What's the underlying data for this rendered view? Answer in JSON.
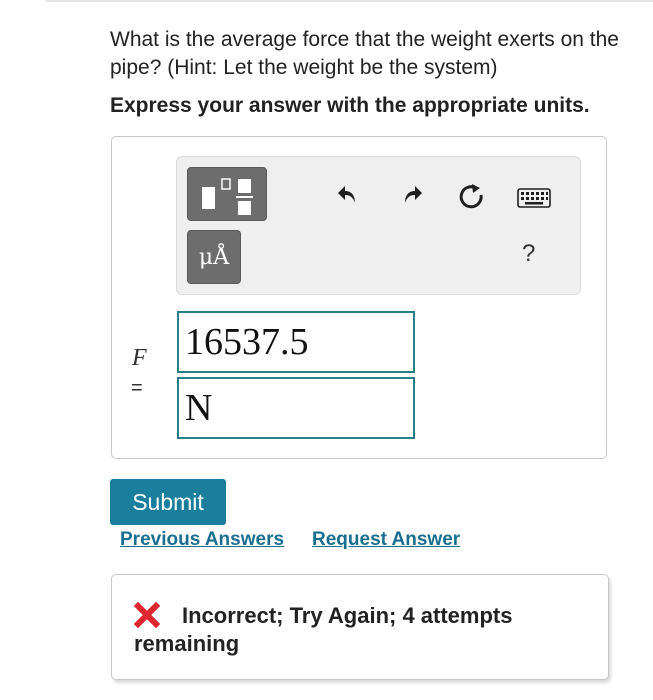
{
  "question": "What is the average force that the weight exerts on the pipe? (Hint: Let the weight be the system)",
  "instruction": "Express your answer with the appropriate units.",
  "toolbar": {
    "mu_label": "μÅ",
    "help_label": "?",
    "icons": [
      "templates-icon",
      "undo-icon",
      "redo-icon",
      "reset-icon",
      "keyboard-icon",
      "help-icon"
    ]
  },
  "answer": {
    "variable": "F",
    "equals": "=",
    "value": "16537.5",
    "unit": "N"
  },
  "actions": {
    "submit_label": "Submit",
    "previous_answers_label": "Previous Answers",
    "request_answer_label": "Request Answer"
  },
  "feedback": {
    "message": "Incorrect; Try Again; 4 attempts remaining",
    "status_color": "#e0262f"
  },
  "colors": {
    "accent": "#1a7e9c",
    "field_border": "#2a7f84",
    "link": "#1a6f90"
  }
}
